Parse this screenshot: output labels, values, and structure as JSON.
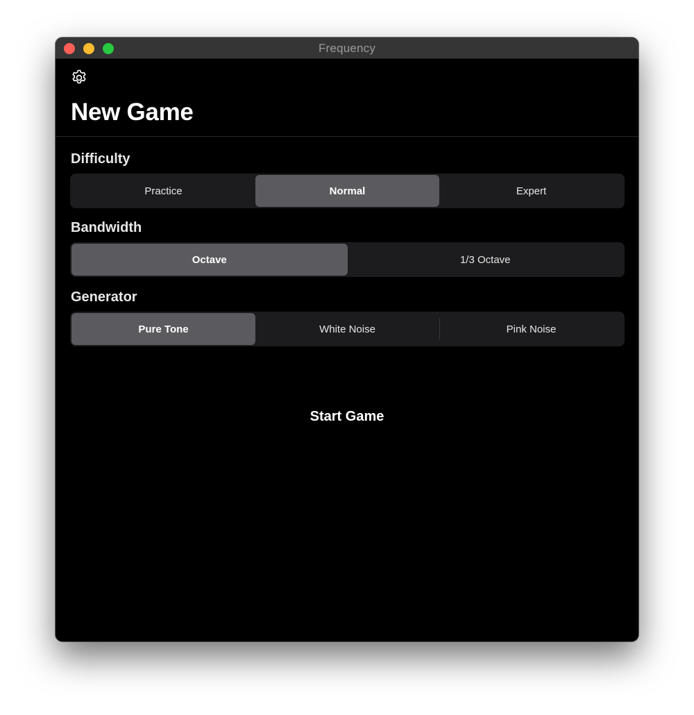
{
  "window": {
    "title": "Frequency",
    "controls": [
      {
        "name": "close",
        "color": "#ff5f57"
      },
      {
        "name": "minimize",
        "color": "#febc2e"
      },
      {
        "name": "zoom",
        "color": "#28c840"
      }
    ]
  },
  "header": {
    "settings_icon": "gear-icon",
    "title": "New Game"
  },
  "difficulty": {
    "label": "Difficulty",
    "options": [
      "Practice",
      "Normal",
      "Expert"
    ],
    "selected": "Normal"
  },
  "bandwidth": {
    "label": "Bandwidth",
    "options": [
      "Octave",
      "1/3 Octave"
    ],
    "selected": "Octave"
  },
  "generator": {
    "label": "Generator",
    "options": [
      "Pure Tone",
      "White Noise",
      "Pink Noise"
    ],
    "selected": "Pure Tone"
  },
  "actions": {
    "start_label": "Start Game"
  },
  "colors": {
    "background": "#000000",
    "segment_background": "#1c1c1e",
    "segment_selected": "#5b5b5f",
    "titlebar": "#353535"
  }
}
